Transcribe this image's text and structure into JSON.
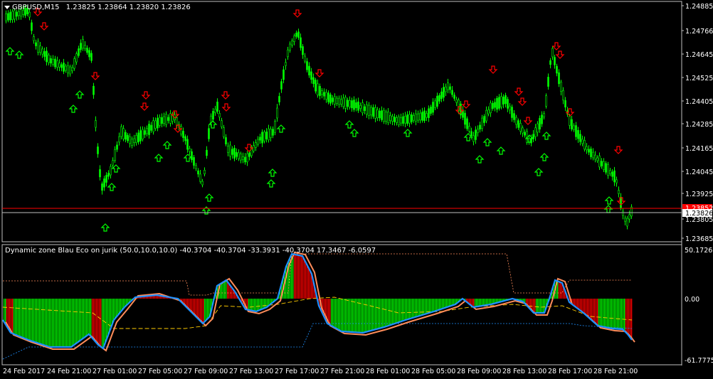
{
  "main_panel": {
    "symbol_label": "GBPUSD,M15",
    "ohlc_readout": "1.23825 1.23864 1.23820 1.23826",
    "price_axis": [
      "1.24885",
      "1.24766",
      "1.24645",
      "1.24525",
      "1.24405",
      "1.24285",
      "1.24165",
      "1.24045",
      "1.23925",
      "1.23805",
      "1.23685"
    ],
    "current_price_tag": "1.23826",
    "red_line_tag": "1.23852"
  },
  "indicator_panel": {
    "title": "Dynamic zone Blau Eco on jurik (50.0,10.0,10.0) -40.3704 -40.3704 -33.3931 -40.3704 17.3467 -6.0597",
    "scale_max": "50.1726",
    "scale_zero": "0.00",
    "scale_min": "-61.7775"
  },
  "time_axis": [
    "24 Feb 2017",
    "24 Feb 21:00",
    "27 Feb 01:00",
    "27 Feb 05:00",
    "27 Feb 09:00",
    "27 Feb 13:00",
    "27 Feb 17:00",
    "27 Feb 21:00",
    "28 Feb 01:00",
    "28 Feb 05:00",
    "28 Feb 09:00",
    "28 Feb 13:00",
    "28 Feb 17:00",
    "28 Feb 21:00"
  ],
  "colors": {
    "candles": "#00ff00",
    "arrow_up": "#00ff00",
    "arrow_down": "#ff0000",
    "hist_pos": "#00ff00",
    "hist_neg": "#ff0000",
    "line_signal": "#ff8c5a",
    "line_main": "#1e90ff",
    "line_level": "#ffcc00",
    "bid_line": "#c0c0c0",
    "ask_line": "#ff0000"
  }
}
